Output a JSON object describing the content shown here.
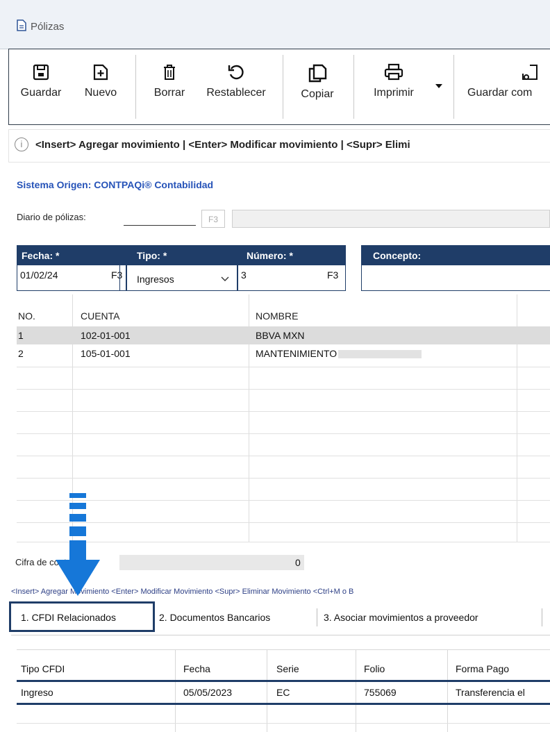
{
  "window": {
    "title": "Pólizas"
  },
  "toolbar": {
    "buttons": [
      {
        "label": "Guardar",
        "icon": "save-icon"
      },
      {
        "label": "Nuevo",
        "icon": "new-document-icon"
      },
      {
        "label": "Borrar",
        "icon": "trash-icon"
      },
      {
        "label": "Restablecer",
        "icon": "restore-icon"
      },
      {
        "label": "Copiar",
        "icon": "copy-icon"
      },
      {
        "label": "Imprimir",
        "icon": "printer-icon"
      },
      {
        "label": "Guardar com",
        "icon": "save-as-icon"
      }
    ]
  },
  "info": {
    "icon": "info-icon",
    "text": "<Insert> Agregar movimiento | <Enter> Modificar movimiento | <Supr> Elimi"
  },
  "sistema_origen": {
    "label": "Sistema Origen:",
    "value": "CONTPAQi® Contabilidad"
  },
  "diario": {
    "label": "Diario de pólizas:",
    "f3": "F3",
    "value": ""
  },
  "header": {
    "fecha": {
      "label": "Fecha: *",
      "value": "01/02/24",
      "f3": "F3"
    },
    "tipo": {
      "label": "Tipo: *",
      "value": "Ingresos"
    },
    "numero": {
      "label": "Número: *",
      "value": "3",
      "f3": "F3"
    },
    "concepto": {
      "label": "Concepto:",
      "value": ""
    }
  },
  "movimientos": {
    "columns": [
      "NO.",
      "CUENTA",
      "NOMBRE"
    ],
    "rows": [
      {
        "no": "1",
        "cuenta": "102-01-001",
        "nombre": "BBVA MXN"
      },
      {
        "no": "2",
        "cuenta": "105-01-001",
        "nombre": "MANTENIMIENTO"
      }
    ]
  },
  "cifra_control": {
    "label": "Cifra de control:",
    "value": "0"
  },
  "shortcuts": "<Insert> Agregar Movimiento    <Enter> Modificar Movimiento    <Supr> Eliminar Movimiento    <Ctrl+M o B",
  "tabs": [
    "1. CFDI Relacionados",
    "2. Documentos Bancarios",
    "3. Asociar movimientos a proveedor"
  ],
  "cfdi": {
    "columns": [
      "Tipo CFDI",
      "Fecha",
      "Serie",
      "Folio",
      "Forma Pago"
    ],
    "rows": [
      {
        "tipo": "Ingreso",
        "fecha": "05/05/2023",
        "serie": "EC",
        "folio": "755069",
        "forma_pago": "Transferencia el"
      }
    ]
  },
  "colors": {
    "header_blue": "#1f3d68",
    "link_blue": "#2653b8",
    "arrow_blue": "#1677d8"
  }
}
